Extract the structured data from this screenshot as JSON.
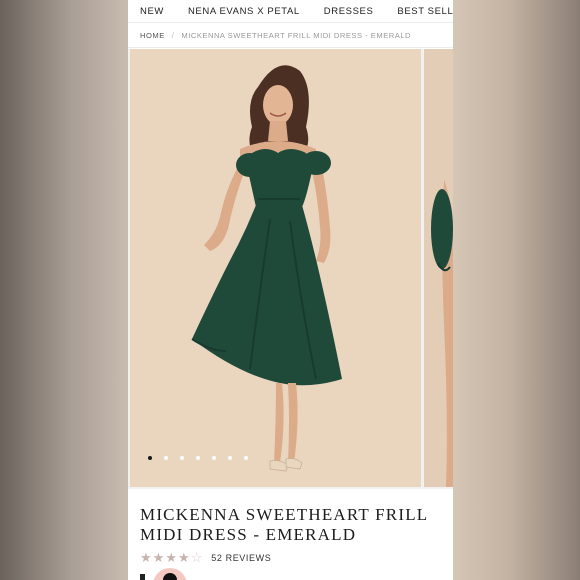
{
  "nav": {
    "items": [
      {
        "label": "NEW"
      },
      {
        "label": "NENA EVANS X PETAL"
      },
      {
        "label": "DRESSES"
      },
      {
        "label": "BEST SELLERS"
      }
    ]
  },
  "breadcrumb": {
    "home": "HOME",
    "separator": "/",
    "current": "MICKENNA SWEETHEART FRILL MIDI DRESS - EMERALD"
  },
  "gallery": {
    "slide_count": 7,
    "active_index": 0
  },
  "product": {
    "title": "MICKENNA SWEETHEART FRILL MIDI DRESS - EMERALD",
    "rating": 4,
    "rating_max": 5,
    "reviews": "52 REVIEWS"
  },
  "colors": {
    "dress": "#1f4a3a",
    "background": "#e9d3bd",
    "star": "#c6b3ad"
  }
}
